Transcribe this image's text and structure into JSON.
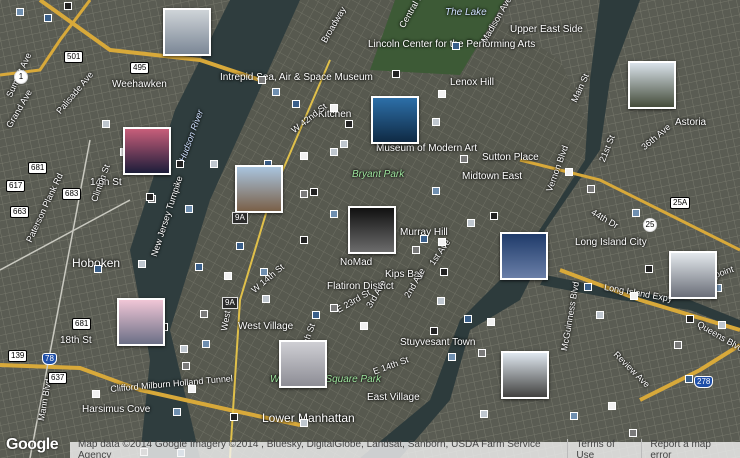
{
  "map": {
    "labels": [
      {
        "text": "Weehawken",
        "kind": "normal"
      },
      {
        "text": "Hoboken",
        "kind": "big"
      },
      {
        "text": "Hudson River",
        "kind": "water"
      },
      {
        "text": "Intrepid Sea, Air & Space Museum",
        "kind": "normal"
      },
      {
        "text": "Lincoln Center for the Performing Arts",
        "kind": "normal"
      },
      {
        "text": "The Lake",
        "kind": "water"
      },
      {
        "text": "Upper East Side",
        "kind": "normal"
      },
      {
        "text": "Lenox Hill",
        "kind": "normal"
      },
      {
        "text": "Bryant Park",
        "kind": "park"
      },
      {
        "text": "Sutton Place",
        "kind": "normal"
      },
      {
        "text": "Midtown East",
        "kind": "normal"
      },
      {
        "text": "Murray Hill",
        "kind": "normal"
      },
      {
        "text": "NoMad",
        "kind": "normal"
      },
      {
        "text": "Kips Bay",
        "kind": "normal"
      },
      {
        "text": "Flatiron District",
        "kind": "normal"
      },
      {
        "text": "West Village",
        "kind": "normal"
      },
      {
        "text": "Stuyvesant Town",
        "kind": "normal"
      },
      {
        "text": "East Village",
        "kind": "normal"
      },
      {
        "text": "Lower Manhattan",
        "kind": "big"
      },
      {
        "text": "Washington Square Park",
        "kind": "park"
      },
      {
        "text": "Long Island City",
        "kind": "normal"
      },
      {
        "text": "Astoria",
        "kind": "normal"
      },
      {
        "text": "Greenpoint",
        "kind": "normal"
      },
      {
        "text": "Harsimus Cove",
        "kind": "normal"
      },
      {
        "text": "Kitchen",
        "kind": "normal"
      },
      {
        "text": "Museum of Modern Art",
        "kind": "normal"
      },
      {
        "text": "14th St",
        "kind": "normal"
      },
      {
        "text": "18th St",
        "kind": "normal"
      },
      {
        "text": "Clinton St",
        "kind": "normal"
      },
      {
        "text": "Paterson Plank Rd",
        "kind": "normal"
      },
      {
        "text": "Palisade Ave",
        "kind": "normal"
      },
      {
        "text": "Summit Ave",
        "kind": "normal"
      },
      {
        "text": "Grand Ave",
        "kind": "normal"
      },
      {
        "text": "New Jersey Turnpike",
        "kind": "normal"
      },
      {
        "text": "Clifford Milburn Holland Tunnel",
        "kind": "normal"
      },
      {
        "text": "W 42nd St",
        "kind": "normal"
      },
      {
        "text": "W 14th St",
        "kind": "normal"
      },
      {
        "text": "E 23rd St",
        "kind": "normal"
      },
      {
        "text": "E 14th St",
        "kind": "normal"
      },
      {
        "text": "Long Island Expy",
        "kind": "normal"
      },
      {
        "text": "44th Dr",
        "kind": "normal"
      },
      {
        "text": "36th Ave",
        "kind": "normal"
      },
      {
        "text": "21st St",
        "kind": "normal"
      },
      {
        "text": "Vernon Blvd",
        "kind": "normal"
      },
      {
        "text": "Main St",
        "kind": "normal"
      },
      {
        "text": "McGuinness Blvd",
        "kind": "normal"
      },
      {
        "text": "Review Ave",
        "kind": "normal"
      },
      {
        "text": "Queens Blvd",
        "kind": "normal"
      },
      {
        "text": "2nd Ave",
        "kind": "normal"
      },
      {
        "text": "3rd Ave",
        "kind": "normal"
      },
      {
        "text": "1st Ave",
        "kind": "normal"
      },
      {
        "text": "Madison Ave",
        "kind": "normal"
      },
      {
        "text": "Central Park",
        "kind": "normal"
      },
      {
        "text": "Broadway",
        "kind": "normal"
      },
      {
        "text": "Church St",
        "kind": "normal"
      },
      {
        "text": "West St",
        "kind": "normal"
      },
      {
        "text": "Marin Blvd",
        "kind": "normal"
      }
    ],
    "shields": [
      {
        "text": "495",
        "kind": "us"
      },
      {
        "text": "501",
        "kind": "us"
      },
      {
        "text": "1",
        "kind": "circle"
      },
      {
        "text": "681",
        "kind": "us"
      },
      {
        "text": "617",
        "kind": "us"
      },
      {
        "text": "663",
        "kind": "us"
      },
      {
        "text": "683",
        "kind": "us"
      },
      {
        "text": "9A",
        "kind": "dark"
      },
      {
        "text": "9A",
        "kind": "dark"
      },
      {
        "text": "681",
        "kind": "us"
      },
      {
        "text": "139",
        "kind": "us"
      },
      {
        "text": "78",
        "kind": "i"
      },
      {
        "text": "637",
        "kind": "us"
      },
      {
        "text": "25",
        "kind": "circle"
      },
      {
        "text": "25A",
        "kind": "us"
      },
      {
        "text": "278",
        "kind": "i"
      }
    ],
    "photos": [
      {
        "name": "aerial-city-photo",
        "colors": [
          "#cfd4d8",
          "#7b8796"
        ]
      },
      {
        "name": "sunset-skyline-photo",
        "colors": [
          "#c85e7a",
          "#1c1d3a"
        ]
      },
      {
        "name": "empire-state-photo",
        "colors": [
          "#2d6fa8",
          "#0f2a44"
        ]
      },
      {
        "name": "chrysler-building-photo",
        "colors": [
          "#a9c4de",
          "#7a6048"
        ]
      },
      {
        "name": "night-city-photo",
        "colors": [
          "#111111",
          "#6c6c6c"
        ]
      },
      {
        "name": "pink-harbor-photo",
        "colors": [
          "#f0c6d6",
          "#6b6f86"
        ]
      },
      {
        "name": "foggy-tower-photo",
        "colors": [
          "#cfcfd4",
          "#8d8d95"
        ]
      },
      {
        "name": "riverside-night-photo",
        "colors": [
          "#1f3b6a",
          "#6a7fa8"
        ]
      },
      {
        "name": "park-walkway-photo",
        "colors": [
          "#d9e2ea",
          "#444c3a"
        ]
      },
      {
        "name": "manhattan-skyline-photo",
        "colors": [
          "#e3e8ec",
          "#6a6e78"
        ]
      },
      {
        "name": "empire-state-skyline-photo",
        "colors": [
          "#dfe7ef",
          "#41413f"
        ]
      }
    ],
    "thumb_colors": [
      "#6f8fb0",
      "#222222",
      "#bfc7cf",
      "#3a5f8a",
      "#f2f2f2",
      "#7a7a7a"
    ]
  },
  "logo": "Google",
  "attribution": {
    "text": "Map data ©2014 Google Imagery ©2014 , Bluesky, DigitalGlobe, Landsat, Sanborn, USDA Farm Service Agency",
    "terms": "Terms of Use",
    "report": "Report a map error"
  }
}
